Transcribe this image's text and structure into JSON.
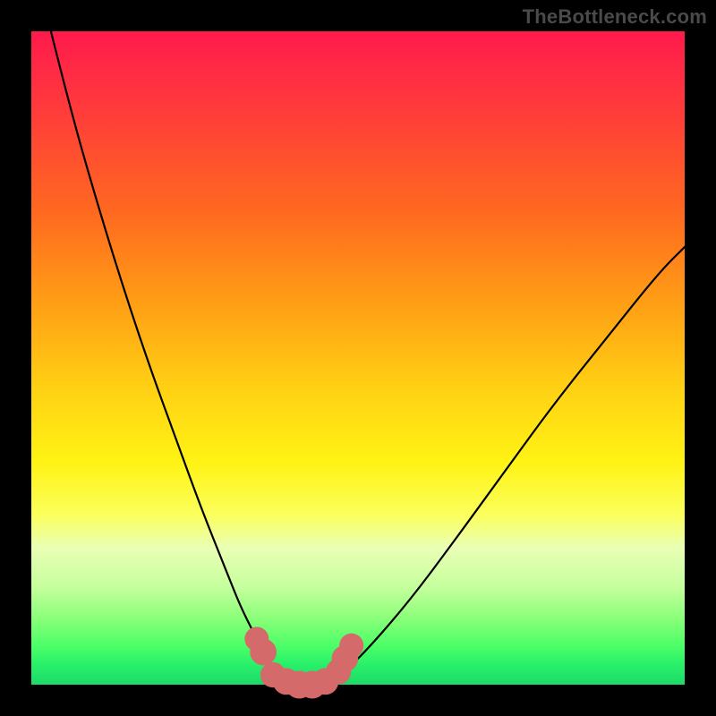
{
  "watermark": "TheBottleneck.com",
  "colors": {
    "frame": "#000000",
    "curve": "#000000",
    "marker_fill": "#d46a6a",
    "marker_stroke": "#b14f4f"
  },
  "chart_data": {
    "type": "line",
    "title": "",
    "xlabel": "",
    "ylabel": "",
    "xlim": [
      0,
      100
    ],
    "ylim": [
      0,
      100
    ],
    "series": [
      {
        "name": "left-branch",
        "x": [
          3,
          6,
          10,
          14,
          18,
          22,
          26,
          30,
          32,
          34,
          36,
          37,
          38
        ],
        "y": [
          100,
          88,
          74,
          61,
          49,
          38,
          27,
          17,
          12,
          8,
          4,
          2,
          0.5
        ]
      },
      {
        "name": "floor",
        "x": [
          38,
          40,
          42,
          44,
          46
        ],
        "y": [
          0.5,
          0,
          0,
          0,
          0.5
        ]
      },
      {
        "name": "right-branch",
        "x": [
          46,
          48,
          52,
          58,
          64,
          72,
          80,
          88,
          96,
          100
        ],
        "y": [
          0.5,
          2,
          6,
          13,
          21,
          32,
          43,
          53,
          63,
          67
        ]
      }
    ],
    "markers": {
      "name": "near-minimum-points",
      "x": [
        34.5,
        35.5,
        37,
        39,
        41,
        43,
        45,
        47,
        48,
        49
      ],
      "y": [
        7,
        5,
        1.5,
        0.5,
        0,
        0,
        0.5,
        2,
        4,
        6
      ],
      "r": [
        1.3,
        1.5,
        1.4,
        1.5,
        1.6,
        1.6,
        1.5,
        1.4,
        1.5,
        1.3
      ]
    }
  }
}
